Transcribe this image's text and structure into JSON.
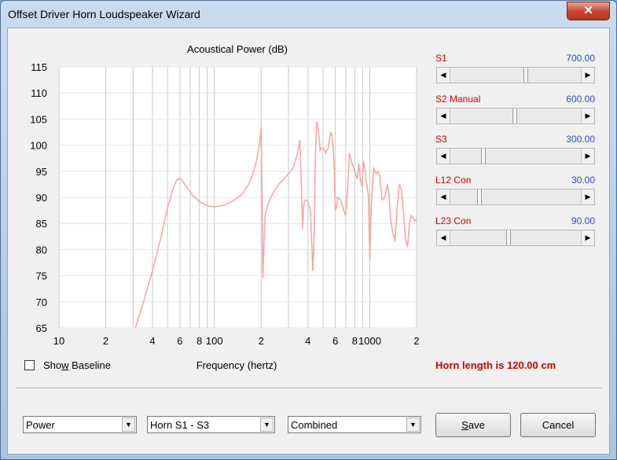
{
  "window": {
    "title": "Offset Driver Horn Loudspeaker Wizard",
    "close_glyph": "✕"
  },
  "chart_data": {
    "type": "line",
    "title": "Acoustical Power (dB)",
    "xlabel": "Frequency (hertz)",
    "ylabel": "",
    "x_scale": "log",
    "xlim": [
      10,
      2000
    ],
    "ylim": [
      65,
      115
    ],
    "grid": true,
    "x_tick_labels": [
      "10",
      "2",
      "4",
      "6",
      "8",
      "100",
      "2",
      "4",
      "6",
      "8",
      "1000",
      "2"
    ],
    "x_tick_values": [
      10,
      20,
      40,
      60,
      80,
      100,
      200,
      400,
      600,
      800,
      1000,
      2000
    ],
    "y_tick_labels": [
      "115",
      "110",
      "105",
      "100",
      "95",
      "90",
      "85",
      "80",
      "75",
      "70",
      "65"
    ],
    "y_tick_values": [
      115,
      110,
      105,
      100,
      95,
      90,
      85,
      80,
      75,
      70,
      65
    ],
    "series_color": "#f4a8a8",
    "series": [
      {
        "x": [
          31,
          35,
          40,
          45,
          50,
          54,
          57,
          60,
          63,
          67,
          72,
          80,
          90,
          100,
          115,
          130,
          150,
          170,
          185,
          195,
          200,
          203,
          205,
          208,
          212,
          220,
          240,
          260,
          290,
          320,
          340,
          355,
          365,
          370,
          372,
          375,
          380,
          390,
          400,
          415,
          430,
          440,
          445,
          450,
          455,
          460,
          470,
          480,
          490,
          500,
          520,
          540,
          560,
          575,
          590,
          600,
          610,
          620,
          650,
          680,
          700,
          720,
          740,
          760,
          780,
          800,
          830,
          850,
          870,
          890,
          910,
          930,
          950,
          980,
          1000,
          1020,
          1040,
          1060,
          1080,
          1100,
          1130,
          1160,
          1200,
          1250,
          1300,
          1330,
          1360,
          1400,
          1450,
          1500,
          1550,
          1600,
          1650,
          1700,
          1750,
          1800,
          1850,
          1900,
          1950,
          2000
        ],
        "y": [
          65,
          70,
          76,
          82,
          88,
          91.5,
          93.3,
          93.6,
          93,
          91.8,
          90.5,
          89.2,
          88.4,
          88.2,
          88.5,
          89.2,
          90.5,
          93,
          96.5,
          100,
          103.5,
          90,
          74.5,
          80,
          86.5,
          88.5,
          91,
          92.5,
          94,
          95.5,
          98,
          101,
          90,
          84,
          86,
          88,
          89.3,
          89.5,
          89.2,
          87.5,
          76,
          84,
          95,
          101,
          104.5,
          104,
          102,
          99,
          99.5,
          99.5,
          98.5,
          99.5,
          102.5,
          101.5,
          96,
          87.5,
          88,
          90,
          89.5,
          87.5,
          86.5,
          91.5,
          98.5,
          97,
          96,
          95,
          93.5,
          96.5,
          93.5,
          92,
          97,
          95.5,
          93,
          90.5,
          78,
          88,
          92,
          95.5,
          95,
          94.5,
          95,
          94,
          89.5,
          90,
          92.5,
          90.5,
          86,
          83.5,
          81.5,
          88,
          92.5,
          91.5,
          87,
          82,
          80.5,
          85,
          86.5,
          86,
          85.5,
          86
        ]
      }
    ]
  },
  "sliders": [
    {
      "label": "S1",
      "value": "700.00",
      "position": 0.57
    },
    {
      "label": "S2  Manual",
      "value": "600.00",
      "position": 0.48
    },
    {
      "label": "S3",
      "value": "300.00",
      "position": 0.24
    },
    {
      "label": "L12  Con",
      "value": "30.00",
      "position": 0.21
    },
    {
      "label": "L23  Con",
      "value": "90.00",
      "position": 0.43
    }
  ],
  "baseline": {
    "label_pre": "Sho",
    "label_accel": "w",
    "label_post": " Baseline",
    "checked": false
  },
  "status": {
    "horn_length_text": "Horn length is 120.00 cm"
  },
  "combos": [
    {
      "value": "Power",
      "arrow_glyph": "▼"
    },
    {
      "value": "Horn S1 - S3",
      "arrow_glyph": "▼"
    },
    {
      "value": "Combined",
      "arrow_glyph": "▼"
    }
  ],
  "buttons": {
    "save_accel": "S",
    "save_rest": "ave",
    "cancel_label": "Cancel"
  },
  "colors": {
    "status_red": "#cc0000",
    "value_blue": "#2a4fb5",
    "plot_bg": "#ffffff",
    "grid": "#c8c8c8",
    "curve": "#f4a8a8"
  }
}
